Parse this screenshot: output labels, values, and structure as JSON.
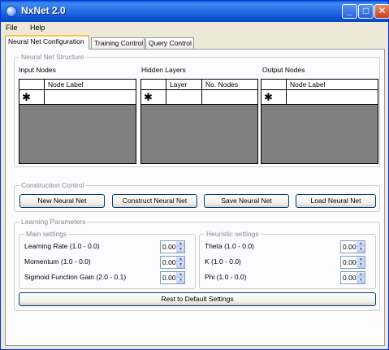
{
  "window": {
    "title": "NxNet 2.0"
  },
  "menu": [
    "File",
    "Help"
  ],
  "tabs": [
    "Neural Net Configuration",
    "Training Control",
    "Query Control"
  ],
  "structure": {
    "title": "Neural Net Structure",
    "input": {
      "label": "Input Nodes",
      "columns": [
        "Node Label"
      ]
    },
    "hidden": {
      "label": "Hidden Layers",
      "columns": [
        "Layer",
        "No. Nodes"
      ]
    },
    "output": {
      "label": "Output Nodes",
      "columns": [
        "Node Label"
      ]
    },
    "new_row_marker": "✱"
  },
  "construction": {
    "title": "Construction Control",
    "buttons": [
      "New Neural Net",
      "Construct Neural Net",
      "Save Neural Net",
      "Load Neural Net"
    ]
  },
  "learning": {
    "title": "Learning Parameters",
    "main": {
      "title": "Main settings",
      "fields": [
        {
          "label": "Learning Rate (1.0 - 0.0)",
          "value": "0.00"
        },
        {
          "label": "Momentum (1.0 - 0.0)",
          "value": "0.00"
        },
        {
          "label": "Sigmoid Function Gain (2.0 - 0.1)",
          "value": "0.00"
        }
      ]
    },
    "heuristic": {
      "title": "Heuristic settings",
      "fields": [
        {
          "label": "Theta (1.0 - 0.0)",
          "value": "0.00"
        },
        {
          "label": "K (1.0 - 0.0)",
          "value": "0.000"
        },
        {
          "label": "Phi (1.0 - 0.0)",
          "value": "0.00"
        }
      ]
    },
    "reset_label": "Rest to Default Settings"
  }
}
